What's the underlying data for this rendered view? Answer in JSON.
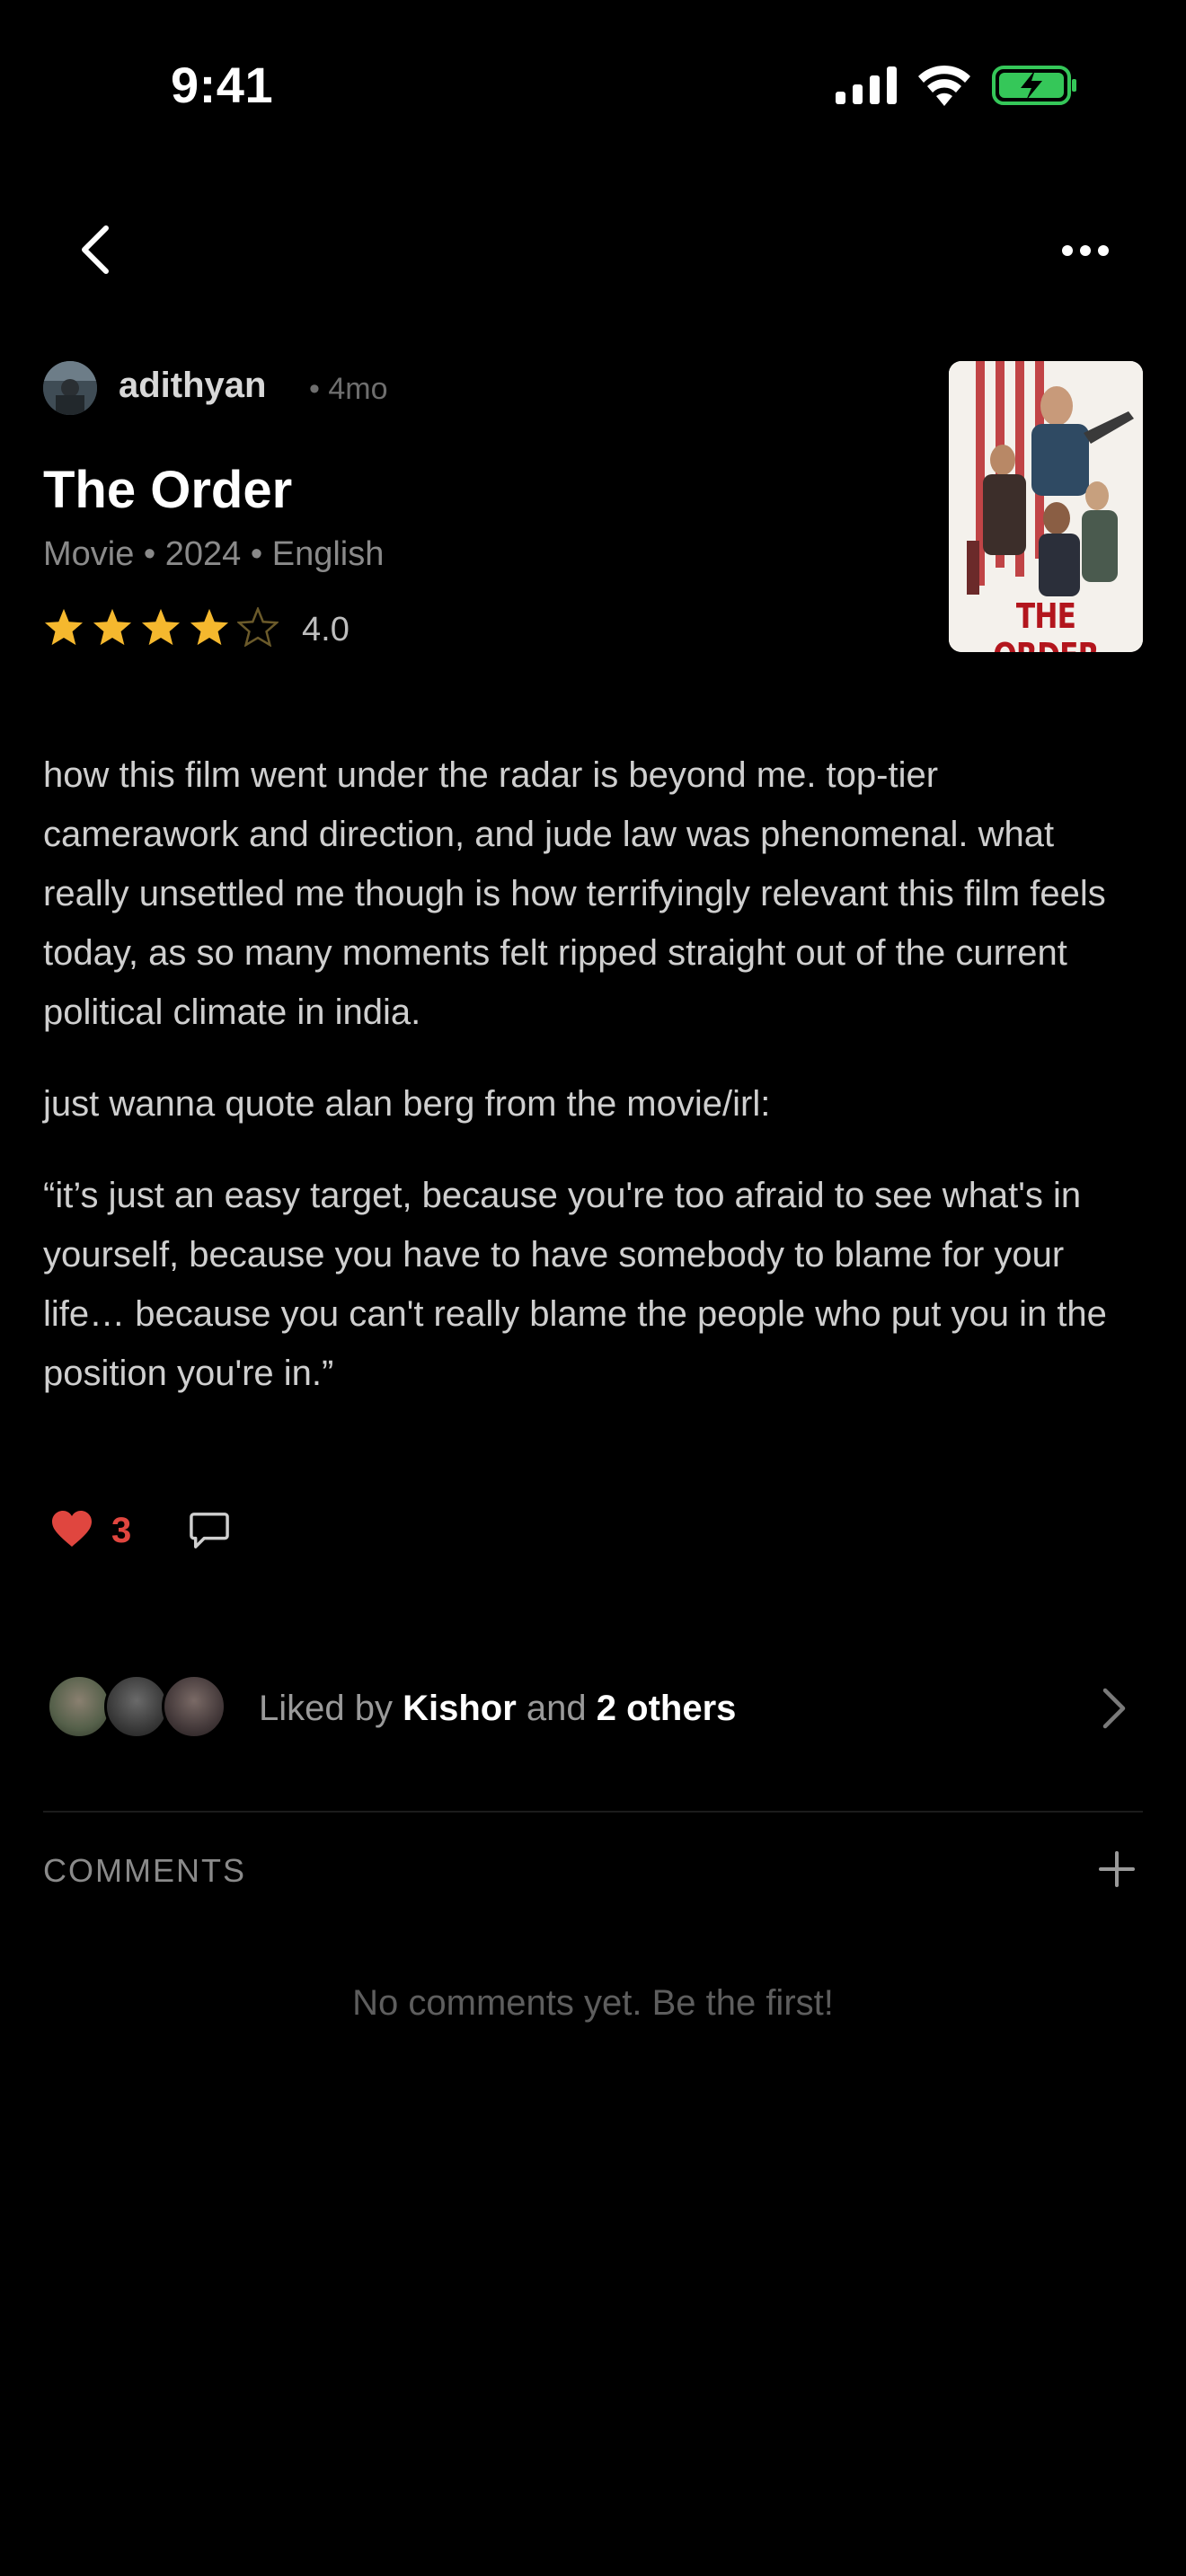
{
  "status_bar": {
    "time": "9:41",
    "icons": [
      "cellular-signal-icon",
      "wifi-icon",
      "battery-charging-icon"
    ],
    "battery_color": "#35c759"
  },
  "nav": {
    "back_icon": "chevron-left-icon",
    "more_icon": "ellipsis-icon"
  },
  "review": {
    "author": "adithyan",
    "time_ago": "• 4mo",
    "movie_title": "The Order",
    "meta": "Movie • 2024 • English",
    "rating": 4.0,
    "rating_text": "4.0",
    "stars_total": 5,
    "poster_title": "THE ORDER",
    "paragraphs": [
      "how this film went under the radar is beyond me. top-tier camerawork and direction, and jude law was phenomenal. what really unsettled me though is how terrifyingly relevant this film feels today, as so many moments felt ripped straight out of the current political climate in india.",
      "just wanna quote alan berg from the movie/irl:",
      "“it’s just an easy target, because you're too afraid to see what's in yourself, because you have to have somebody to blame for your life… because you can't really blame the people who put you in the position you're in.”"
    ]
  },
  "actions": {
    "like_count": "3",
    "like_color": "#e0463f",
    "star_color": "#f5b82e"
  },
  "liked_by": {
    "prefix": "Liked by",
    "name": "Kishor",
    "middle": "and",
    "others": "2 others"
  },
  "comments": {
    "heading": "COMMENTS",
    "empty_text": "No comments yet. Be the first!"
  }
}
